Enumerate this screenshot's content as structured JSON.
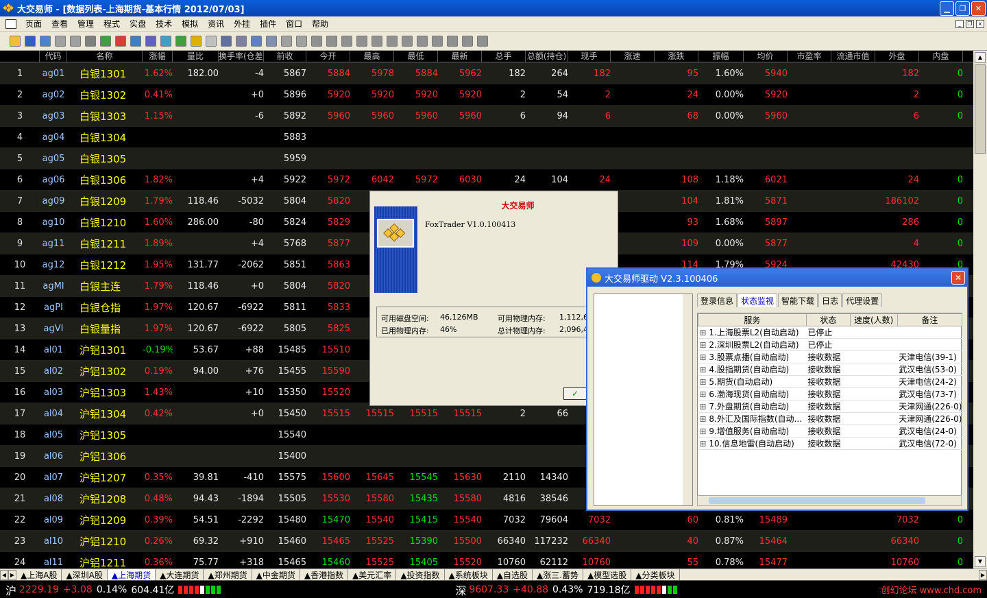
{
  "window": {
    "title": "大交易师 - [数据列表-上海期货-基本行情 2012/07/03]"
  },
  "menu": [
    "页面",
    "查看",
    "管理",
    "程式",
    "实盘",
    "技术",
    "模拟",
    "资讯",
    "外挂",
    "插件",
    "窗口",
    "帮助"
  ],
  "columns": [
    "代码",
    "名称",
    "涨幅",
    "量比",
    "换手率(仓差)",
    "前收",
    "今开",
    "最高",
    "最低",
    "最新",
    "总手",
    "总额(持仓)",
    "现手",
    "涨速",
    "涨跌",
    "振幅",
    "均价",
    "市盈率",
    "流通市值",
    "外盘",
    "内盘"
  ],
  "colors": {
    "up": "#ff3030",
    "down": "#00e000",
    "flat": "#e8e8e8",
    "name": "#ffff00",
    "code": "#9ac8ff"
  },
  "rows": [
    [
      "1",
      "ag01",
      "白银1301",
      "1.62%",
      "182.00",
      "-4",
      "5867",
      "5884",
      "5978",
      "5884",
      "5962",
      "182",
      "264",
      "182",
      "",
      "95",
      "1.60%",
      "5940",
      "",
      "",
      "182",
      "0"
    ],
    [
      "2",
      "ag02",
      "白银1302",
      "0.41%",
      "",
      "+0",
      "5896",
      "5920",
      "5920",
      "5920",
      "5920",
      "2",
      "54",
      "2",
      "",
      "24",
      "0.00%",
      "5920",
      "",
      "",
      "2",
      "0"
    ],
    [
      "3",
      "ag03",
      "白银1303",
      "1.15%",
      "",
      "-6",
      "5892",
      "5960",
      "5960",
      "5960",
      "5960",
      "6",
      "94",
      "6",
      "",
      "68",
      "0.00%",
      "5960",
      "",
      "",
      "6",
      "0"
    ],
    [
      "4",
      "ag04",
      "白银1304",
      "",
      "",
      "",
      "5883",
      "",
      "",
      "",
      "",
      "",
      "",
      "",
      "",
      "",
      "",
      "",
      "",
      "",
      "",
      ""
    ],
    [
      "5",
      "ag05",
      "白银1305",
      "",
      "",
      "",
      "5959",
      "",
      "",
      "",
      "",
      "",
      "",
      "",
      "",
      "",
      "",
      "",
      "",
      "",
      "",
      ""
    ],
    [
      "6",
      "ag06",
      "白银1306",
      "1.82%",
      "",
      "+4",
      "5922",
      "5972",
      "6042",
      "5972",
      "6030",
      "24",
      "104",
      "24",
      "",
      "108",
      "1.18%",
      "6021",
      "",
      "",
      "24",
      "0"
    ],
    [
      "7",
      "ag09",
      "白银1209",
      "1.79%",
      "118.46",
      "-5032",
      "5804",
      "5820",
      "",
      "",
      "",
      "",
      "",
      "",
      "",
      "104",
      "1.81%",
      "5871",
      "",
      "",
      "186102",
      "0"
    ],
    [
      "8",
      "ag10",
      "白银1210",
      "1.60%",
      "286.00",
      "-80",
      "5824",
      "5829",
      "",
      "",
      "",
      "",
      "",
      "",
      "",
      "93",
      "1.68%",
      "5897",
      "",
      "",
      "286",
      "0"
    ],
    [
      "9",
      "ag11",
      "白银1211",
      "1.89%",
      "",
      "+4",
      "5768",
      "5877",
      "",
      "",
      "",
      "",
      "",
      "",
      "",
      "109",
      "0.00%",
      "5877",
      "",
      "",
      "4",
      "0"
    ],
    [
      "10",
      "ag12",
      "白银1212",
      "1.95%",
      "131.77",
      "-2062",
      "5851",
      "5863",
      "",
      "",
      "",
      "",
      "",
      "",
      "",
      "114",
      "1.79%",
      "5924",
      "",
      "",
      "42430",
      "0"
    ],
    [
      "11",
      "agMI",
      "白银主连",
      "1.79%",
      "118.46",
      "+0",
      "5804",
      "5820",
      "",
      "",
      "",
      "",
      "",
      "",
      "",
      "",
      "",
      "",
      "",
      "",
      "",
      ""
    ],
    [
      "12",
      "agPI",
      "白银仓指",
      "1.97%",
      "120.67",
      "-6922",
      "5811",
      "5833",
      "",
      "",
      "",
      "",
      "",
      "",
      "",
      "",
      "",
      "",
      "",
      "",
      "",
      ""
    ],
    [
      "13",
      "agVI",
      "白银量指",
      "1.97%",
      "120.67",
      "-6922",
      "5805",
      "5825",
      "",
      "",
      "",
      "",
      "",
      "",
      "",
      "",
      "",
      "",
      "",
      "",
      "",
      ""
    ],
    [
      "14",
      "al01",
      "沪铝1301",
      "-0.19%",
      "53.67",
      "+88",
      "15485",
      "15510",
      "15",
      "",
      "",
      "",
      "",
      "",
      "",
      "",
      "",
      "",
      "",
      "",
      "",
      ""
    ],
    [
      "15",
      "al02",
      "沪铝1302",
      "0.19%",
      "94.00",
      "+76",
      "15455",
      "15590",
      "15",
      "",
      "",
      "",
      "",
      "",
      "",
      "",
      "",
      "",
      "",
      "",
      "",
      ""
    ],
    [
      "16",
      "al03",
      "沪铝1303",
      "1.43%",
      "",
      "+10",
      "15350",
      "15520",
      "15",
      "",
      "",
      "",
      "",
      "",
      "",
      "",
      "",
      "",
      "",
      "",
      "",
      ""
    ],
    [
      "17",
      "al04",
      "沪铝1304",
      "0.42%",
      "",
      "+0",
      "15450",
      "15515",
      "15515",
      "15515",
      "15515",
      "2",
      "66",
      "",
      "",
      "",
      "",
      "",
      "",
      "",
      "",
      ""
    ],
    [
      "18",
      "al05",
      "沪铝1305",
      "",
      "",
      "",
      "15540",
      "",
      "",
      "",
      "",
      "",
      "",
      "",
      "",
      "",
      "",
      "",
      "",
      "",
      "",
      ""
    ],
    [
      "19",
      "al06",
      "沪铝1306",
      "",
      "",
      "",
      "15400",
      "",
      "",
      "",
      "",
      "",
      "",
      "",
      "",
      "",
      "",
      "",
      "",
      "",
      "",
      ""
    ],
    [
      "20",
      "al07",
      "沪铝1207",
      "0.35%",
      "39.81",
      "-410",
      "15575",
      "15600",
      "15645",
      "15545",
      "15630",
      "2110",
      "14340",
      "",
      "",
      "",
      "",
      "",
      "",
      "",
      "",
      ""
    ],
    [
      "21",
      "al08",
      "沪铝1208",
      "0.48%",
      "94.43",
      "-1894",
      "15505",
      "15530",
      "15580",
      "15435",
      "15580",
      "4816",
      "38546",
      "",
      "",
      "",
      "",
      "",
      "",
      "",
      "",
      ""
    ],
    [
      "22",
      "al09",
      "沪铝1209",
      "0.39%",
      "54.51",
      "-2292",
      "15480",
      "15470",
      "15540",
      "15415",
      "15540",
      "7032",
      "79604",
      "7032",
      "",
      "60",
      "0.81%",
      "15489",
      "",
      "",
      "7032",
      "0"
    ],
    [
      "23",
      "al10",
      "沪铝1210",
      "0.26%",
      "69.32",
      "+910",
      "15460",
      "15465",
      "15525",
      "15390",
      "15500",
      "66340",
      "117232",
      "66340",
      "",
      "40",
      "0.87%",
      "15464",
      "",
      "",
      "66340",
      "0"
    ],
    [
      "24",
      "al11",
      "沪铝1211",
      "0.36%",
      "75.77",
      "+318",
      "15465",
      "15460",
      "15525",
      "15405",
      "15520",
      "10760",
      "62112",
      "10760",
      "",
      "55",
      "0.78%",
      "15477",
      "",
      "",
      "10760",
      "0"
    ]
  ],
  "tabs": [
    "▲上海A股",
    "▲深圳A股",
    "▲上海期货",
    "▲大连期货",
    "▲郑州期货",
    "▲中金期货",
    "▲香港指数",
    "▲美元汇率",
    "▲投资指数",
    "▲系统板块",
    "▲自选股",
    "▲涨三.蓄势",
    "▲模型选股",
    "▲分类板块"
  ],
  "active_tab": 2,
  "status": {
    "sh_label": "沪",
    "sh_index": "2229.19",
    "sh_change": "+3.08",
    "sh_pct": "0.14%",
    "sh_amount": "604.41亿",
    "sz_label": "深",
    "sz_index": "9607.33",
    "sz_change": "+40.88",
    "sz_pct": "0.43%",
    "sz_amount": "719.18亿",
    "brand": "创幻论坛 www.chd.com"
  },
  "about": {
    "title": "大交易师",
    "version": "FoxTrader V1.0.100413",
    "disk_label": "可用磁盘空间:",
    "disk_value": "46,126MB",
    "mem_used_label": "已用物理内存:",
    "mem_used_value": "46%",
    "phys_avail_label": "可用物理内存:",
    "phys_avail_value": "1,112,6",
    "phys_total_label": "总计物理内存:",
    "phys_total_value": "2,096,4",
    "ok": "✓"
  },
  "driver": {
    "title": "大交易师驱动  V2.3.100406",
    "tabs": [
      "登录信息",
      "状态监视",
      "智能下载",
      "日志",
      "代理设置"
    ],
    "active_tab": 1,
    "columns": [
      "服务",
      "状态",
      "速度(人数)",
      "备注"
    ],
    "rows": [
      [
        "1.上海股票L2(自动启动)",
        "已停止",
        "",
        ""
      ],
      [
        "2.深圳股票L2(自动启动)",
        "已停止",
        "",
        ""
      ],
      [
        "3.股票点播(自动启动)",
        "接收数据",
        "",
        "天津电信(39-1)"
      ],
      [
        "4.股指期货(自动启动)",
        "接收数据",
        "",
        "武汉电信(53-0)"
      ],
      [
        "5.期货(自动启动)",
        "接收数据",
        "",
        "天津电信(24-2)"
      ],
      [
        "6.渤海现货(自动启动)",
        "接收数据",
        "",
        "武汉电信(73-7)"
      ],
      [
        "7.外盘期货(自动启动)",
        "接收数据",
        "",
        "天津网通(226-0)"
      ],
      [
        "8.外汇及国际指数(自动...",
        "接收数据",
        "",
        "天津网通(226-0)"
      ],
      [
        "9.增值服务(自动启动)",
        "接收数据",
        "",
        "武汉电信(24-0)"
      ],
      [
        "10.信息地雷(自动启动)",
        "接收数据",
        "",
        "武汉电信(72-0)"
      ]
    ]
  }
}
